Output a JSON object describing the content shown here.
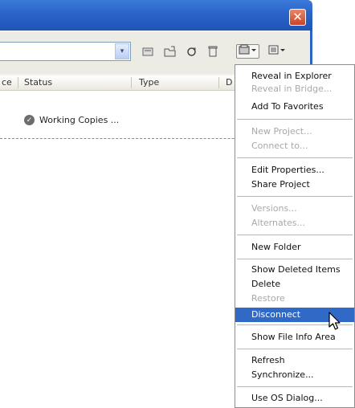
{
  "window": {
    "close_glyph": "✕"
  },
  "toolbar": {
    "path_value": "",
    "combo_arrow": "▾",
    "icons": [
      "file-icon",
      "open-folder-icon",
      "refresh-icon",
      "trash-icon",
      "project-menu-icon",
      "view-menu-icon"
    ]
  },
  "columns": {
    "c0": "ce",
    "c1": "Status",
    "c2": "Type",
    "c3": "D"
  },
  "rows": [
    {
      "label": "Working Copies ..."
    }
  ],
  "menu": {
    "items": [
      {
        "label": "Reveal in Explorer",
        "enabled": true
      },
      {
        "label": "Reveal in Bridge...",
        "enabled": false
      },
      {
        "label": "Add To Favorites",
        "enabled": true
      },
      {
        "label": "New Project...",
        "enabled": false
      },
      {
        "label": "Connect to...",
        "enabled": false
      },
      {
        "label": "Edit Properties...",
        "enabled": true
      },
      {
        "label": "Share Project",
        "enabled": true
      },
      {
        "label": "Versions...",
        "enabled": false
      },
      {
        "label": "Alternates...",
        "enabled": false
      },
      {
        "label": "New Folder",
        "enabled": true
      },
      {
        "label": "Show Deleted Items",
        "enabled": true
      },
      {
        "label": "Delete",
        "enabled": true
      },
      {
        "label": "Restore",
        "enabled": false
      },
      {
        "label": "Disconnect",
        "enabled": true,
        "selected": true
      },
      {
        "label": "Show File Info Area",
        "enabled": true
      },
      {
        "label": "Refresh",
        "enabled": true
      },
      {
        "label": "Synchronize...",
        "enabled": true
      },
      {
        "label": "Use OS Dialog...",
        "enabled": true
      }
    ]
  },
  "colors": {
    "titlebar": "#2b63c9",
    "selection": "#3169c6",
    "disabled_text": "#a8a8a8"
  }
}
